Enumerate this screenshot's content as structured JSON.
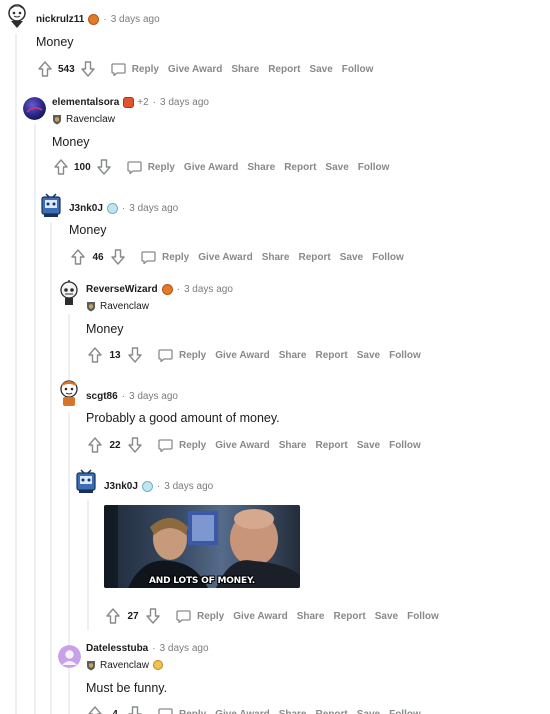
{
  "actions": {
    "reply": "Reply",
    "give_award": "Give Award",
    "share": "Share",
    "report": "Report",
    "save": "Save",
    "follow": "Follow"
  },
  "comments": [
    {
      "author": "nickrulz11",
      "time": "3 days ago",
      "flair": "",
      "body": "Money",
      "score": "543"
    },
    {
      "author": "elementalsora",
      "extra_awards": "+2",
      "time": "3 days ago",
      "flair": "Ravenclaw",
      "body": "Money",
      "score": "100"
    },
    {
      "author": "J3nk0J",
      "time": "3 days ago",
      "flair": "",
      "body": "Money",
      "score": "46"
    },
    {
      "author": "ReverseWizard",
      "time": "3 days ago",
      "flair": "Ravenclaw",
      "body": "Money",
      "score": "13"
    },
    {
      "author": "scgt86",
      "time": "3 days ago",
      "flair": "",
      "body": "Probably a good amount of money.",
      "score": "22"
    },
    {
      "author": "J3nk0J",
      "time": "3 days ago",
      "flair": "",
      "body": "",
      "gif_caption": "AND LOTS OF MONEY.",
      "score": "27"
    },
    {
      "author": "Datelesstuba",
      "time": "3 days ago",
      "flair": "Ravenclaw",
      "body": "Must be funny.",
      "score": "4"
    }
  ],
  "colors": {
    "thread_line": "#edeff1",
    "meta_gray": "#7c7c7c",
    "action_gray": "#878a8c",
    "text": "#1c1c1c"
  }
}
